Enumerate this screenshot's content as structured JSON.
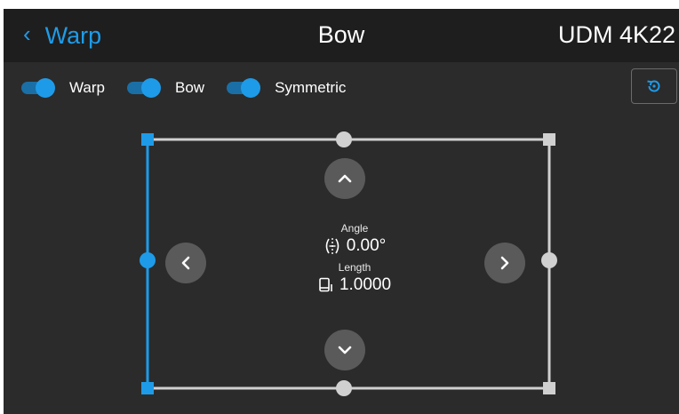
{
  "header": {
    "back_label": "Warp",
    "title": "Bow",
    "device": "UDM 4K22"
  },
  "toggles": [
    {
      "label": "Warp",
      "on": true
    },
    {
      "label": "Bow",
      "on": true
    },
    {
      "label": "Symmetric",
      "on": true
    }
  ],
  "info": {
    "angle_caption": "Angle",
    "angle_value": "0.00°",
    "length_caption": "Length",
    "length_value": "1.0000"
  },
  "colors": {
    "accent": "#1e9be8",
    "background": "#2b2b2b",
    "header": "#1e1e1e",
    "frame": "#d0d0d0"
  },
  "icons": {
    "back": "chevron-left-icon",
    "reset": "reset-icon",
    "up": "chevron-up-icon",
    "down": "chevron-down-icon",
    "left": "chevron-left-icon",
    "right": "chevron-right-icon",
    "angle": "angle-icon",
    "length": "length-icon"
  },
  "selection": {
    "active_side": "left"
  }
}
